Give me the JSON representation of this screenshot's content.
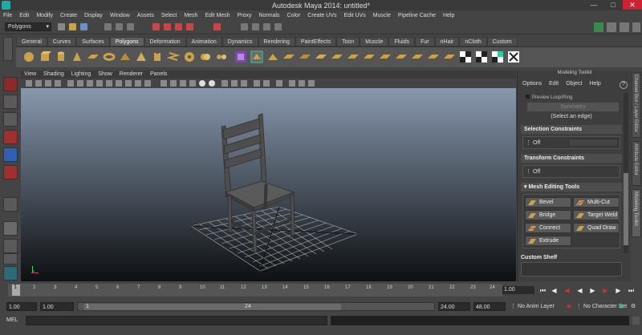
{
  "window": {
    "title": "Autodesk Maya 2014: untitled*"
  },
  "menubar": [
    "File",
    "Edit",
    "Modify",
    "Create",
    "Display",
    "Window",
    "Assets",
    "Select",
    "Mesh",
    "Edit Mesh",
    "Proxy",
    "Normals",
    "Color",
    "Create UVs",
    "Edit UVs",
    "Muscle",
    "Pipeline Cache",
    "Help"
  ],
  "status": {
    "mode": "Polygons"
  },
  "shelf": {
    "tabs": [
      "General",
      "Curves",
      "Surfaces",
      "Polygons",
      "Deformation",
      "Animation",
      "Dynamics",
      "Rendering",
      "PaintEffects",
      "Toon",
      "Muscle",
      "Fluids",
      "Fur",
      "nHair",
      "nCloth",
      "Custom"
    ],
    "active_tab": "Polygons"
  },
  "panel": {
    "menu": [
      "View",
      "Shading",
      "Lighting",
      "Show",
      "Renderer",
      "Panels"
    ]
  },
  "toolkit": {
    "title": "Modeling Toolkit",
    "menu": [
      "Options",
      "Edit",
      "Object",
      "Help"
    ],
    "help_glyph": "?",
    "partial_top": "Preview Loop/Ring",
    "symmetry": "Symmetry",
    "select_edge_hint": "(Select an edge)",
    "sections": {
      "selection_constraints": "Selection Constraints",
      "transform_constraints": "Transform Constraints",
      "mesh_editing_tools": "Mesh Editing Tools"
    },
    "off_label": "Off",
    "tools": [
      "Bevel",
      "Multi-Cut",
      "Bridge",
      "Target Weld",
      "Connect",
      "Quad Draw",
      "Extrude"
    ],
    "custom_shelf": "Custom Shelf"
  },
  "side_tabs": [
    "Channel Box / Layer Editor",
    "Attribute Editor",
    "Modeling Toolkit"
  ],
  "timeline": {
    "ticks": [
      "1",
      "2",
      "3",
      "4",
      "5",
      "6",
      "7",
      "8",
      "9",
      "10",
      "11",
      "12",
      "13",
      "14",
      "15",
      "16",
      "17",
      "18",
      "19",
      "20",
      "21",
      "22",
      "23",
      "24"
    ],
    "current_frame": "1.00",
    "current_marker": "1"
  },
  "range": {
    "start": "1.00",
    "playback_start": "1.00",
    "slider_start": "1",
    "slider_end": "24",
    "playback_end": "24.00",
    "end": "48.00",
    "anim_layer": "No Anim Layer",
    "char_set": "No Character Set"
  },
  "cmd": {
    "label": "MEL"
  }
}
